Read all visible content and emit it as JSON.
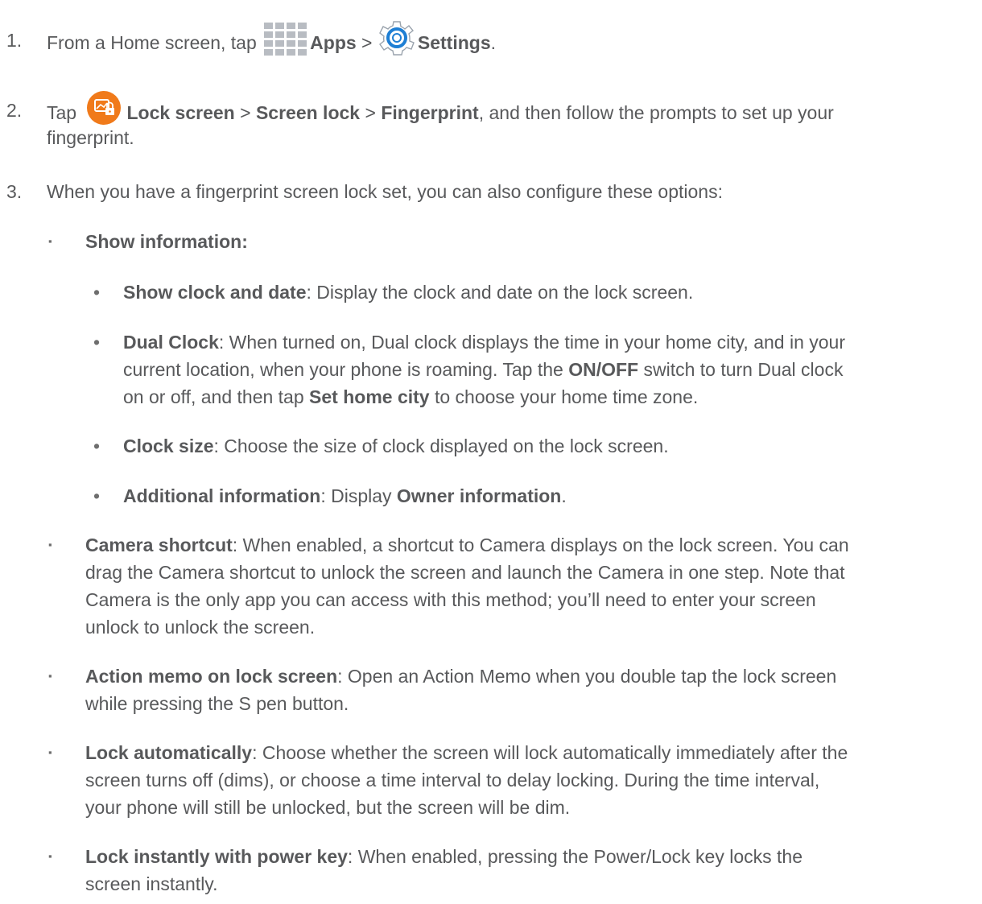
{
  "steps": [
    {
      "num": "1.",
      "t1": "From a Home screen, tap",
      "apps_label": "Apps",
      "sep": ">",
      "settings_label": "Settings",
      "end": "."
    },
    {
      "num": "2.",
      "t1": "Tap",
      "lock_screen": "Lock screen",
      "sep1": ">",
      "screen_lock": "Screen lock",
      "sep2": ">",
      "fingerprint": "Fingerprint",
      "t2": ", and then follow the prompts to set up your",
      "t3": "fingerprint."
    },
    {
      "num": "3.",
      "text": "When you have a fingerprint screen lock set, you can also configure these options:"
    }
  ],
  "bullet_square": "▪",
  "bullet_dot": "•",
  "options": {
    "show_info": {
      "label": "Show information:"
    },
    "show_clock": {
      "label": "Show clock and date",
      "text": ": Display the clock and date on the lock screen."
    },
    "dual_clock": {
      "label": "Dual Clock",
      "l1": ": When turned on, Dual clock displays the time in your home city, and in your",
      "l2a": "current location, when your phone is roaming. Tap the ",
      "l2b": "ON/OFF",
      "l2c": " switch to turn Dual clock",
      "l3a": "on or off, and then tap ",
      "l3b": "Set home city",
      "l3c": " to choose your home time zone."
    },
    "clock_size": {
      "label": "Clock size",
      "text": ": Choose the size of clock displayed on the lock screen."
    },
    "additional": {
      "label": "Additional information",
      "text": ": Display ",
      "owner": "Owner information",
      "end": "."
    },
    "camera_shortcut": {
      "label": "Camera shortcut",
      "l1": ": When enabled, a shortcut to Camera displays on the lock screen. You can",
      "l2": "drag the Camera shortcut to unlock the screen and launch the Camera in one step. Note that",
      "l3": "Camera is the only app you can access with this method; you’ll need to enter your screen",
      "l4": "unlock to unlock the screen."
    },
    "action_memo": {
      "label": "Action memo on lock screen",
      "l1": ": Open an Action Memo when you double tap the lock screen",
      "l2": "while pressing the S pen button."
    },
    "lock_auto": {
      "label": "Lock automatically",
      "l1": ": Choose whether the screen will lock automatically immediately after the",
      "l2": "screen turns off (dims), or choose a time interval to delay locking. During the time interval,",
      "l3": "your phone will still be unlocked, but the screen will be dim."
    },
    "lock_power": {
      "label": "Lock instantly with power key",
      "l1": ": When enabled, pressing the Power/Lock key locks the",
      "l2": "screen instantly."
    }
  },
  "colors": {
    "text": "#58595b",
    "apps_icon": "#b8bcc2",
    "settings_ring": "#1f7fd4",
    "lock_icon_bg": "#f07a1a"
  }
}
